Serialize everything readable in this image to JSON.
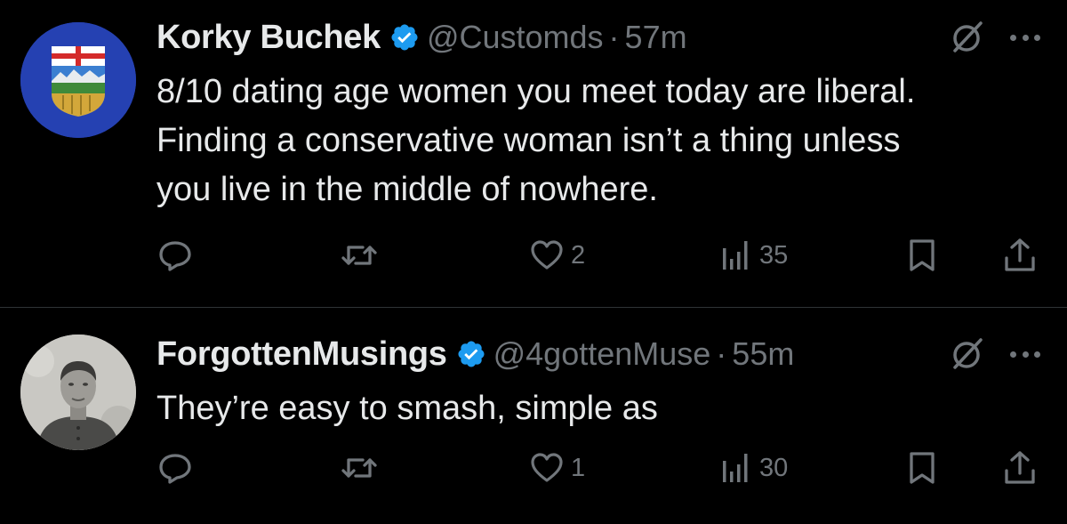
{
  "colors": {
    "background": "#000000",
    "text_primary": "#e7e9ea",
    "text_secondary": "#71767b",
    "verified_blue": "#1d9bf0",
    "divider": "#2f3336"
  },
  "tweets": [
    {
      "author_name": "Korky Buchek",
      "verified": true,
      "handle": "@Customds",
      "separator": "·",
      "time": "57m",
      "avatar_icon": "alberta-coat-of-arms-avatar",
      "text_lines": [
        "8/10 dating age women you meet today are liberal.",
        "Finding a conservative woman isn’t a thing unless",
        "you live in the middle of nowhere."
      ],
      "actions": {
        "reply_count": "",
        "retweet_count": "",
        "like_count": "2",
        "views_count": "35"
      },
      "icons": [
        "grok-icon",
        "more-icon",
        "reply-icon",
        "retweet-icon",
        "heart-icon",
        "views-icon",
        "bookmark-icon",
        "share-icon"
      ]
    },
    {
      "author_name": "ForgottenMusings",
      "verified": true,
      "handle": "@4gottenMuse",
      "separator": "·",
      "time": "55m",
      "avatar_icon": "vintage-portrait-avatar",
      "text_lines": [
        "They’re easy to smash, simple as"
      ],
      "actions": {
        "reply_count": "",
        "retweet_count": "",
        "like_count": "1",
        "views_count": "30"
      },
      "icons": [
        "grok-icon",
        "more-icon",
        "reply-icon",
        "retweet-icon",
        "heart-icon",
        "views-icon",
        "bookmark-icon",
        "share-icon"
      ]
    }
  ]
}
